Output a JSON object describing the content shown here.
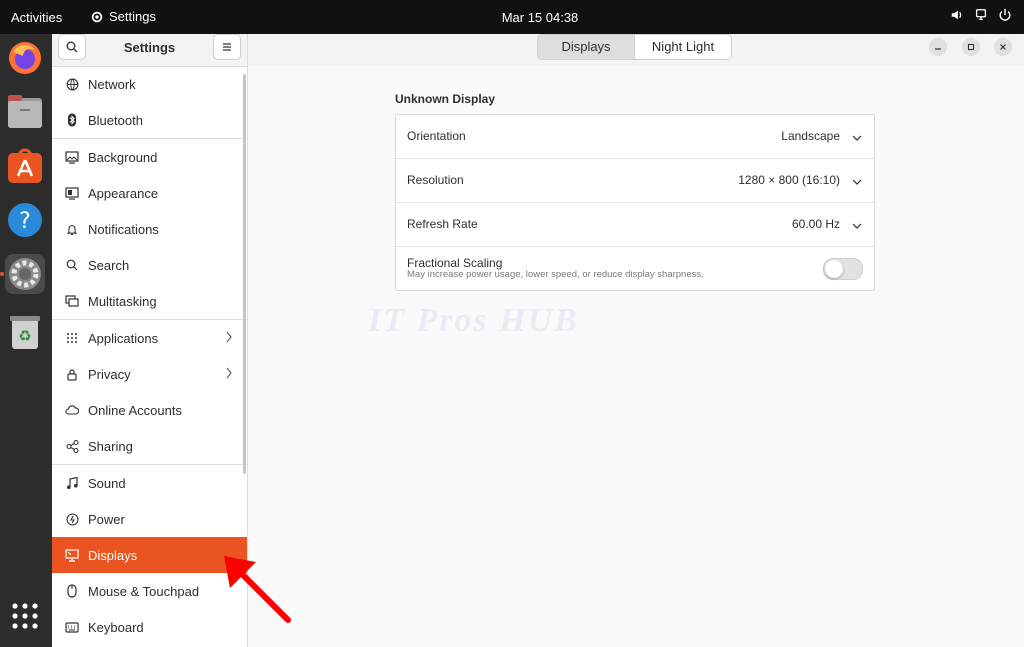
{
  "topbar": {
    "activities": "Activities",
    "app_name": "Settings",
    "clock": "Mar 15  04:38"
  },
  "dock": {
    "items": [
      "firefox-icon",
      "files-icon",
      "app-center-icon",
      "help-icon",
      "settings-icon",
      "trash-icon",
      "app-grid-icon"
    ]
  },
  "sidebar": {
    "title": "Settings",
    "items": [
      {
        "label": "Network",
        "icon": "network-icon"
      },
      {
        "label": "Bluetooth",
        "icon": "bluetooth-icon"
      },
      {
        "label": "Background",
        "icon": "background-icon"
      },
      {
        "label": "Appearance",
        "icon": "appearance-icon"
      },
      {
        "label": "Notifications",
        "icon": "bell-icon"
      },
      {
        "label": "Search",
        "icon": "search-icon"
      },
      {
        "label": "Multitasking",
        "icon": "multitasking-icon"
      },
      {
        "label": "Applications",
        "icon": "apps-grid-icon"
      },
      {
        "label": "Privacy",
        "icon": "lock-icon"
      },
      {
        "label": "Online Accounts",
        "icon": "cloud-icon"
      },
      {
        "label": "Sharing",
        "icon": "share-icon"
      },
      {
        "label": "Sound",
        "icon": "music-note-icon"
      },
      {
        "label": "Power",
        "icon": "power-icon"
      },
      {
        "label": "Displays",
        "icon": "display-icon"
      },
      {
        "label": "Mouse & Touchpad",
        "icon": "mouse-icon"
      },
      {
        "label": "Keyboard",
        "icon": "keyboard-icon"
      }
    ],
    "active": "Displays"
  },
  "header": {
    "tabs": [
      "Displays",
      "Night Light"
    ]
  },
  "display": {
    "name": "Unknown Display",
    "orientation_label": "Orientation",
    "orientation_value": "Landscape",
    "resolution_label": "Resolution",
    "resolution_value": "1280 × 800 (16:10)",
    "refresh_label": "Refresh Rate",
    "refresh_value": "60.00 Hz",
    "scaling_label": "Fractional Scaling",
    "scaling_desc": "May increase power usage, lower speed, or reduce display sharpness.",
    "scaling_enabled": false
  },
  "watermark": "IT Pros HUB",
  "colors": {
    "accent": "#e95420",
    "arrow": "#ff0000"
  }
}
